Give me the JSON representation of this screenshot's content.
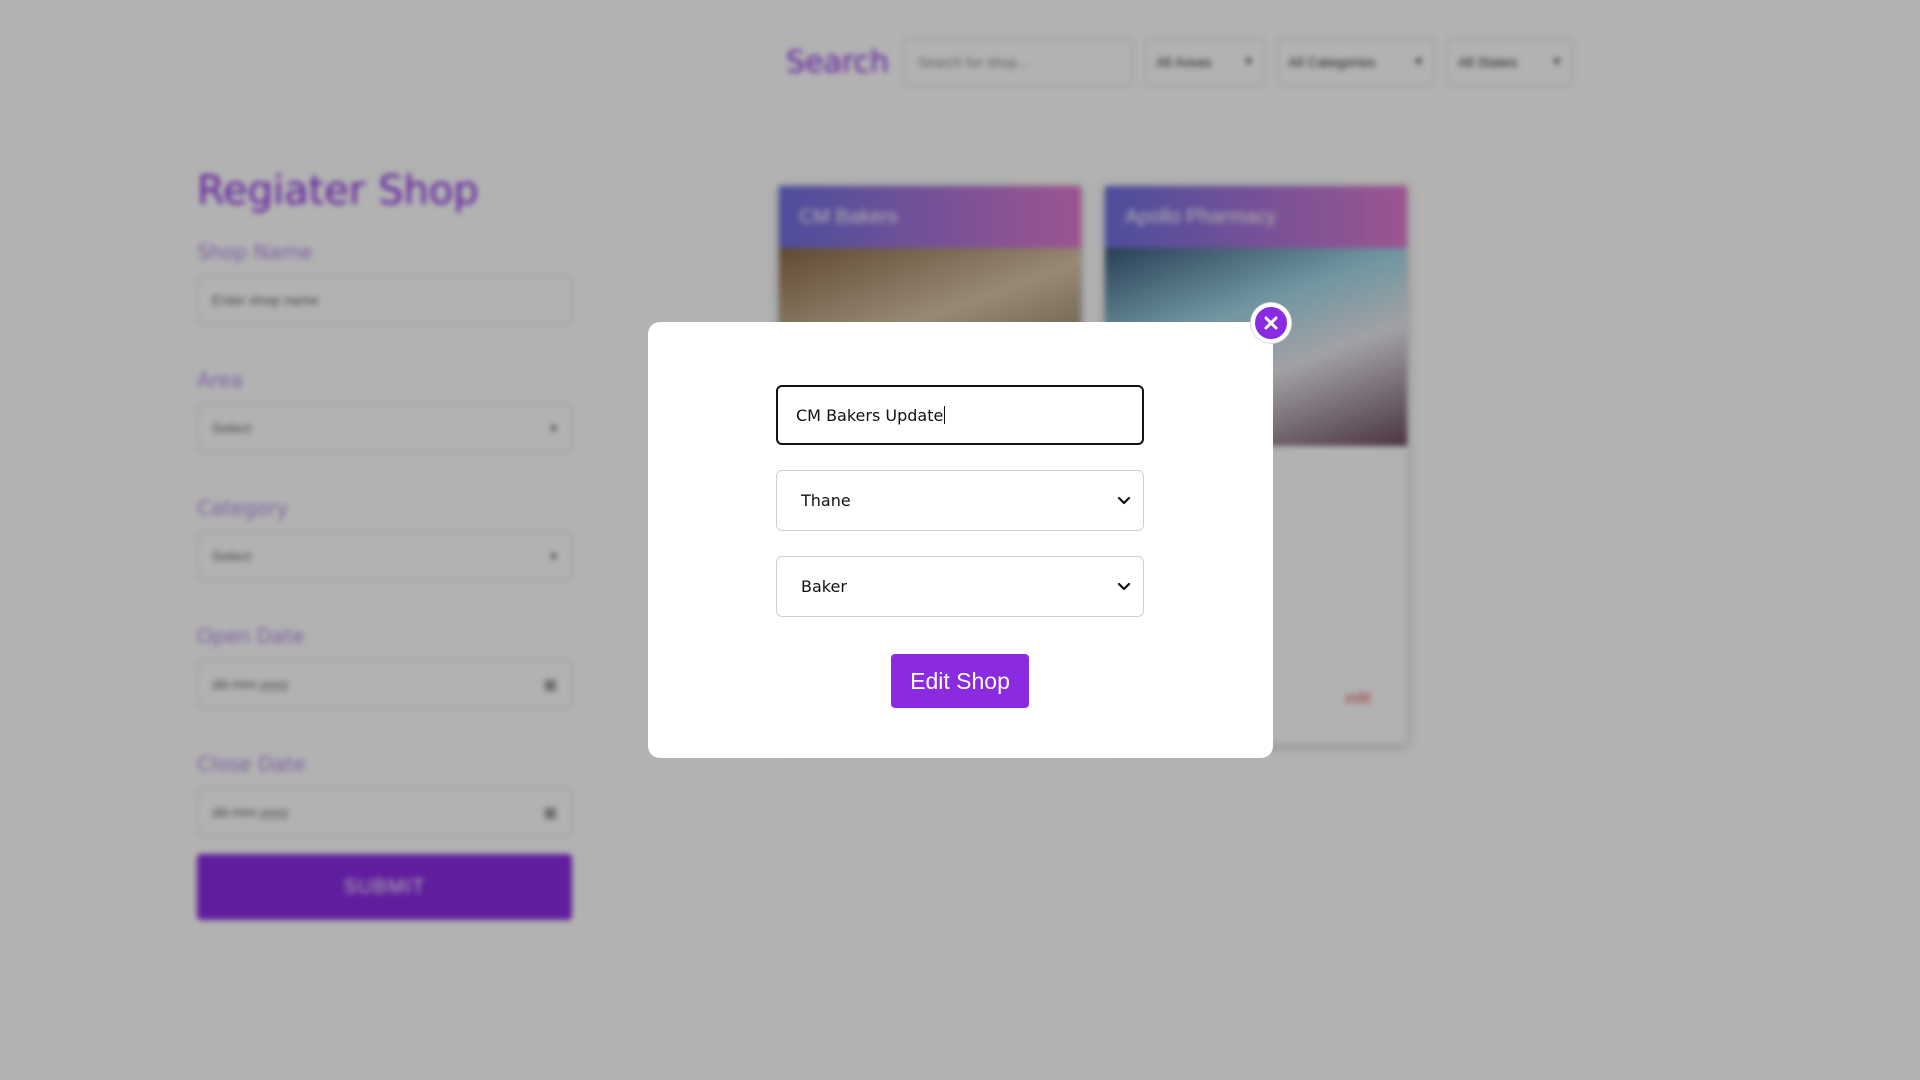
{
  "background": {
    "search": {
      "label": "Search",
      "placeholder": "Search for shop...",
      "area_filter": "All Areas",
      "category_filter": "All Categories",
      "state_filter": "All States"
    },
    "register_form": {
      "title": "Regiater Shop",
      "shop_name_label": "Shop Name",
      "shop_name_placeholder": "Enter shop name",
      "area_label": "Area",
      "area_value": "Select",
      "category_label": "Category",
      "category_value": "Select",
      "open_date_label": "Open Date",
      "open_date_value": "dd-mm-yyyy",
      "close_date_label": "Close Date",
      "close_date_value": "dd-mm-yyyy",
      "submit_label": "SUBMIT"
    },
    "cards": [
      {
        "name": "CM Bakers"
      },
      {
        "name": "Apollo Pharmacy",
        "edit_label": "edit"
      }
    ]
  },
  "modal": {
    "name_value": "CM Bakers Update",
    "area_value": "Thane",
    "category_value": "Baker",
    "submit_label": "Edit Shop"
  },
  "colors": {
    "accent": "#8a2be2",
    "overlay": "rgba(0,0,0,0.30)"
  },
  "icons": {
    "close": "close-icon",
    "dropdown": "chevron-down-icon",
    "calendar": "calendar-icon"
  }
}
